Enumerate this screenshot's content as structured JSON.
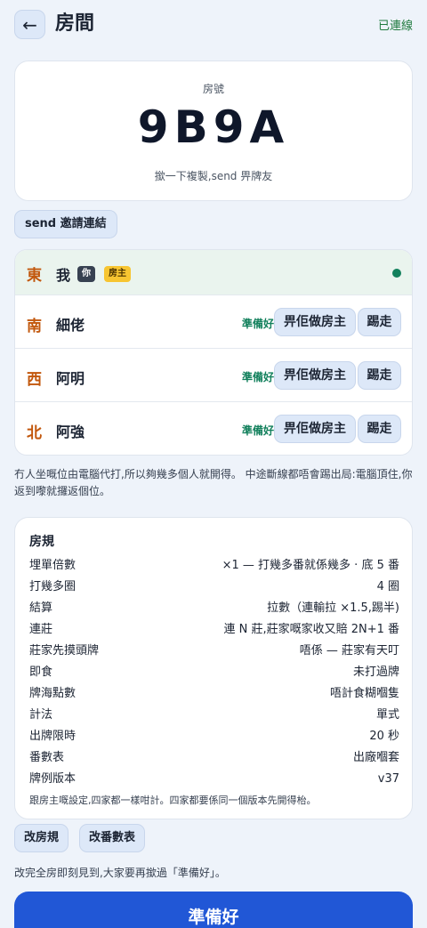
{
  "header": {
    "back_glyph": "←",
    "title": "房間",
    "status": "已連線"
  },
  "room": {
    "label": "房號",
    "code": "9B9A",
    "hint": "撳一下複製,send 畀牌友"
  },
  "invite_label": "send 邀請連結",
  "players": [
    {
      "seat": "東",
      "name": "我",
      "you_badge": "你",
      "host_badge": "房主"
    },
    {
      "seat": "南",
      "name": "細佬",
      "status": "準備好",
      "make_host": "畀佢做房主",
      "kick": "踢走"
    },
    {
      "seat": "西",
      "name": "阿明",
      "status": "準備好",
      "make_host": "畀佢做房主",
      "kick": "踢走"
    },
    {
      "seat": "北",
      "name": "阿強",
      "status": "準備好",
      "make_host": "畀佢做房主",
      "kick": "踢走"
    }
  ],
  "note": "冇人坐嘅位由電腦代打,所以夠幾多個人就開得。 中途斷線都唔會踢出局:電腦頂住,你返到嚟就攞返個位。",
  "rules": {
    "title": "房規",
    "rows": [
      {
        "k": "埋單倍數",
        "v": "×1 — 打幾多番就係幾多 · 底 5 番"
      },
      {
        "k": "打幾多圈",
        "v": "4 圈"
      },
      {
        "k": "結算",
        "v": "拉數（連輸拉 ×1.5,踢半)"
      },
      {
        "k": "連莊",
        "v": "連 N 莊,莊家嘅家收又賠 2N+1 番"
      },
      {
        "k": "莊家先摸頭牌",
        "v": "唔係 — 莊家有天叮"
      },
      {
        "k": "即食",
        "v": "未打過牌"
      },
      {
        "k": "牌海點數",
        "v": "唔計食糊嗰隻"
      },
      {
        "k": "計法",
        "v": "單式"
      },
      {
        "k": "出牌限時",
        "v": "20 秒"
      },
      {
        "k": "番數表",
        "v": "出廠嗰套"
      },
      {
        "k": "牌例版本",
        "v": "v37"
      }
    ],
    "footer": "跟房主嘅設定,四家都一樣咁計。四家都要係同一個版本先開得枱。"
  },
  "buttons": {
    "edit_rules": "改房規",
    "edit_table": "改番數表",
    "ready": "準備好"
  },
  "footer_note": "改完全房即刻見到,大家要再撳過「準備好」。"
}
